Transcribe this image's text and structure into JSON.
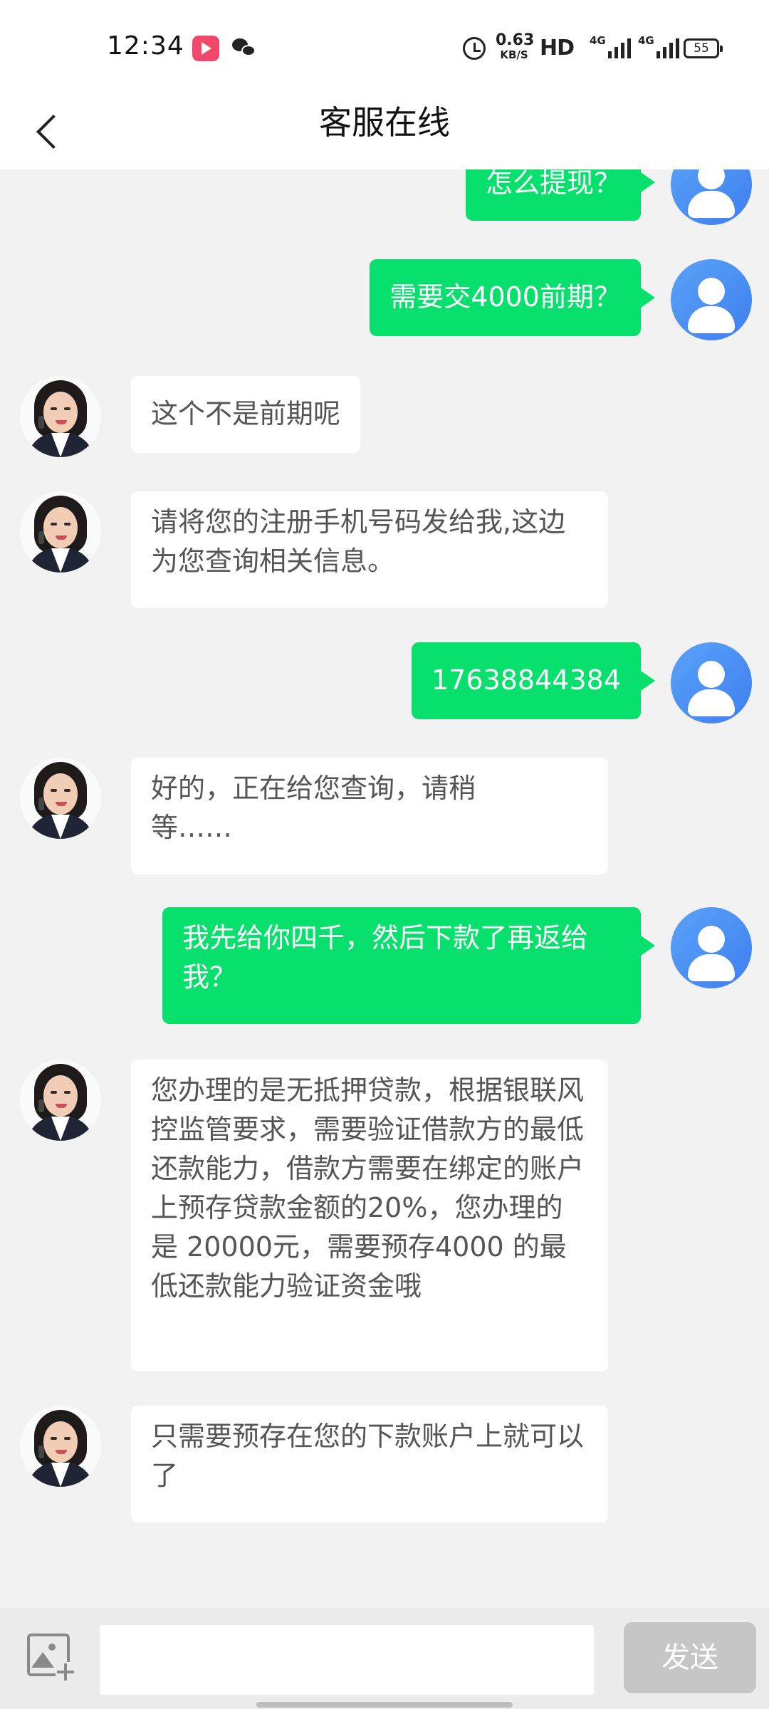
{
  "status_bar": {
    "time": "12:34",
    "net_speed_value": "0.63",
    "net_speed_unit": "KB/S",
    "hd": "HD",
    "signal1": "4G",
    "signal2": "4G",
    "battery": "55"
  },
  "header": {
    "title": "客服在线"
  },
  "messages": [
    {
      "from": "me",
      "text": "怎么提现？"
    },
    {
      "from": "me",
      "text": "需要交4000前期？"
    },
    {
      "from": "agent",
      "text": "这个不是前期呢"
    },
    {
      "from": "agent",
      "text": "请将您的注册手机号码发给我,这边为您查询相关信息。"
    },
    {
      "from": "me",
      "text": "17638844384"
    },
    {
      "from": "agent",
      "text": "好的，正在给您查询，请稍等……"
    },
    {
      "from": "me",
      "text": "我先给你四千，然后下款了再返给我？"
    },
    {
      "from": "agent",
      "text": "您办理的是无抵押贷款，根据银联风控监管要求，需要验证借款方的最低还款能力，借款方需要在绑定的账户上预存贷款金额的20%，您办理的是 20000元，需要预存4000 的最低还款能力验证资金哦"
    },
    {
      "from": "agent",
      "text": "只需要预存在您的下款账户上就可以了"
    }
  ],
  "input": {
    "placeholder": "",
    "value": ""
  },
  "send_label": "发送",
  "colors": {
    "my_bubble": "#08e06e",
    "agent_bubble": "#ffffff",
    "background": "#f2f2f2",
    "user_avatar": "#4a90f5"
  }
}
